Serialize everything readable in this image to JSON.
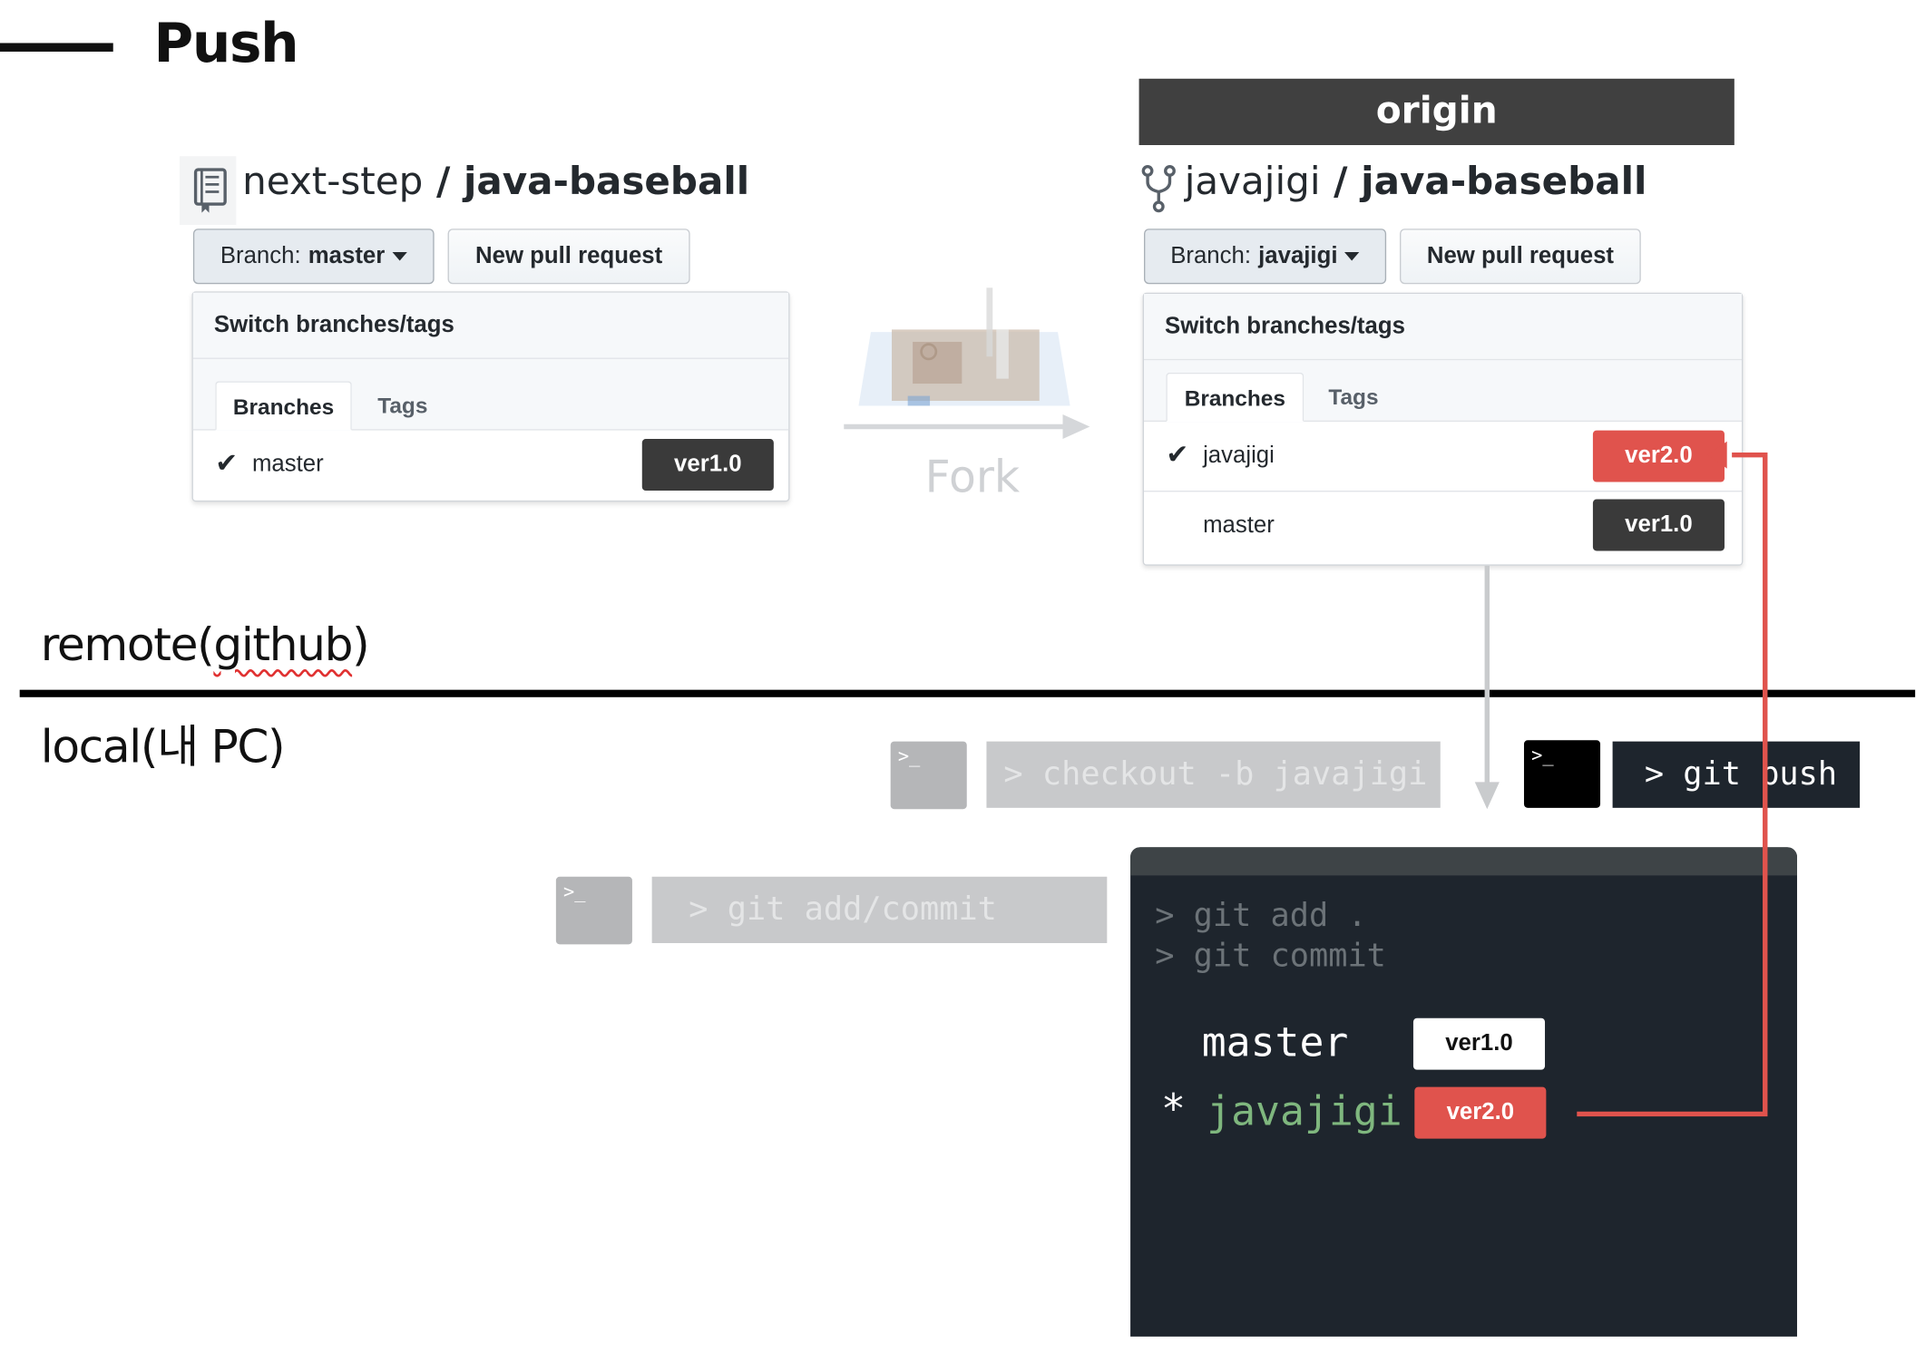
{
  "slide": {
    "title": "Push",
    "origin_label": "origin"
  },
  "left_repo": {
    "owner": "next-step",
    "separator": " / ",
    "name": "java-baseball",
    "branch_label": "Branch:",
    "branch_value": "master",
    "pr_button": "New pull request",
    "panel_title": "Switch branches/tags",
    "tabs": [
      "Branches",
      "Tags"
    ],
    "branches": [
      {
        "name": "master",
        "checked": true,
        "tag": "ver1.0"
      }
    ]
  },
  "right_repo": {
    "owner": "javajigi",
    "separator": " / ",
    "name": "java-baseball",
    "branch_label": "Branch:",
    "branch_value": "javajigi",
    "pr_button": "New pull request",
    "panel_title": "Switch branches/tags",
    "tabs": [
      "Branches",
      "Tags"
    ],
    "branches": [
      {
        "name": "javajigi",
        "checked": true,
        "tag": "ver2.0"
      },
      {
        "name": "master",
        "checked": false,
        "tag": "ver1.0"
      }
    ]
  },
  "fork_label": "Fork",
  "remote_label_prefix": "remote(",
  "remote_label_word": "github",
  "remote_label_suffix": ")",
  "local_label": "local(내 PC)",
  "commands": {
    "terminal_glyph": ">_",
    "checkout": "> checkout -b javajigi",
    "push": "> git push",
    "add_commit": "> git add/commit"
  },
  "console": {
    "lines": [
      "> git add .",
      "> git commit"
    ],
    "branches": [
      {
        "marker": "",
        "name": "master",
        "tag": "ver1.0"
      },
      {
        "marker": "*",
        "name": "javajigi",
        "tag": "ver2.0"
      }
    ]
  },
  "colors": {
    "accent_red": "#e0534d",
    "dark_tag": "#3a3a3a",
    "console_bg": "#1e252d",
    "current_branch_green": "#7fb77e"
  }
}
